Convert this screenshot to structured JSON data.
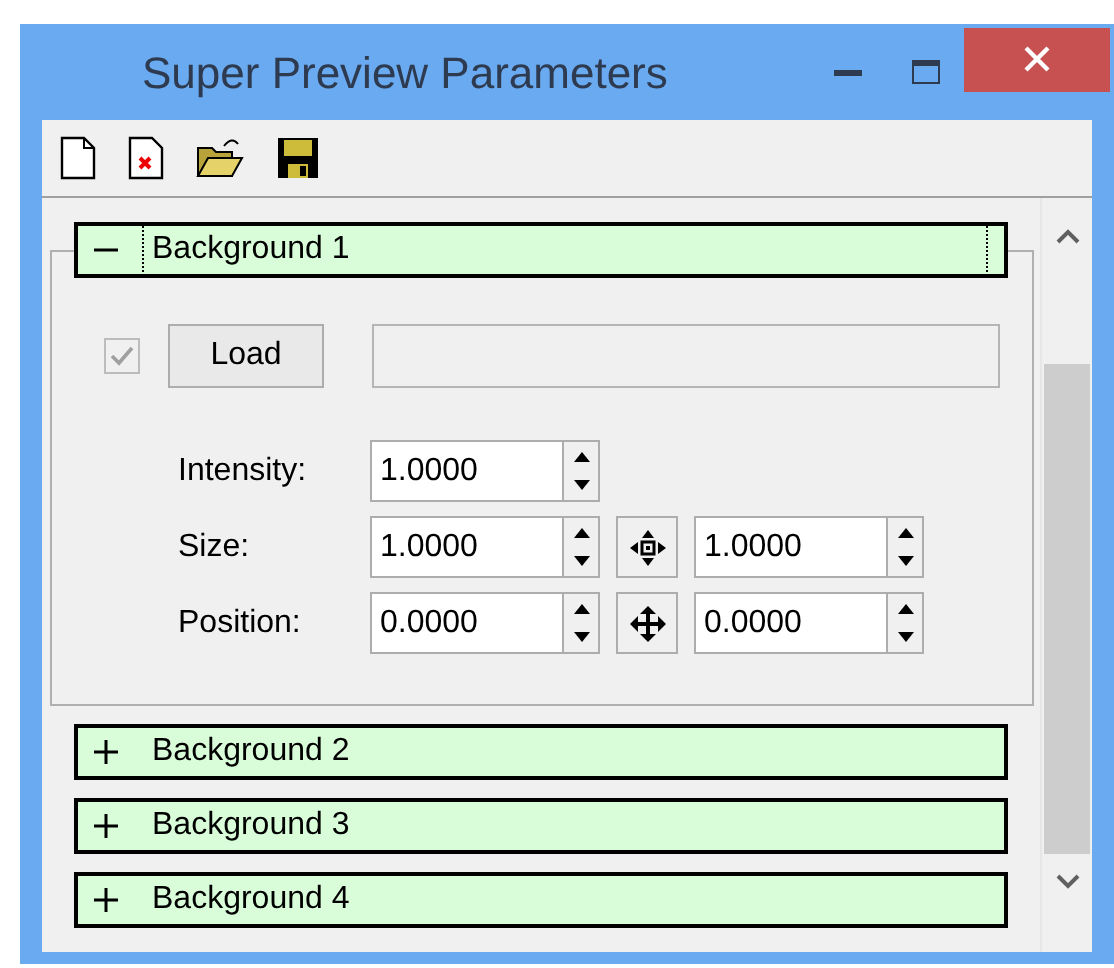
{
  "window": {
    "title": "Super Preview Parameters"
  },
  "backgrounds": [
    {
      "title": "Background 1",
      "expanded": true,
      "focused": true,
      "enabled": {
        "checked": true,
        "disabled": true
      },
      "load_button": "Load",
      "params": [
        {
          "label": "Intensity:",
          "values": [
            "1.0000"
          ]
        },
        {
          "label": "Size:",
          "values": [
            "1.0000",
            "1.0000"
          ],
          "kind": "scale"
        },
        {
          "label": "Position:",
          "values": [
            "0.0000",
            "0.0000"
          ],
          "kind": "move"
        }
      ]
    },
    {
      "title": "Background 2",
      "expanded": false,
      "focused": false
    },
    {
      "title": "Background 3",
      "expanded": false,
      "focused": false
    },
    {
      "title": "Background 4",
      "expanded": false,
      "focused": false
    }
  ]
}
